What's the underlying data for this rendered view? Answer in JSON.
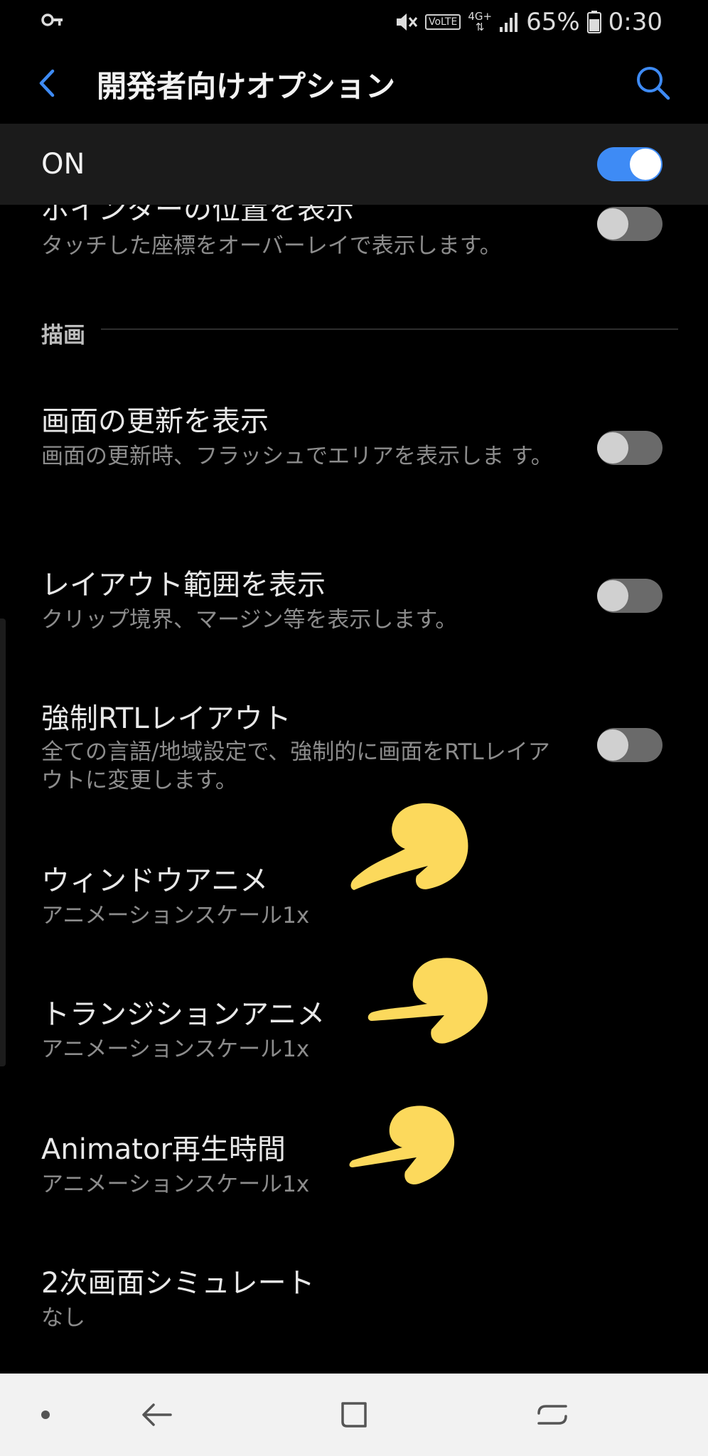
{
  "status_bar": {
    "volte": "VoLTE",
    "network": "4G+",
    "battery_percent": "65%",
    "time": "0:30"
  },
  "header": {
    "title": "開発者向けオプション"
  },
  "master_switch": {
    "label": "ON",
    "state": true
  },
  "rows": {
    "pointer_location": {
      "title": "ポインターの位置を表示",
      "subtitle": "タッチした座標をオーバーレイで表示します。",
      "enabled": false
    },
    "section": "描画",
    "show_surface_updates": {
      "title": "画面の更新を表示",
      "subtitle": "画面の更新時、フラッシュでエリアを表示しま す。",
      "enabled": false
    },
    "show_layout_bounds": {
      "title": "レイアウト範囲を表示",
      "subtitle": "クリップ境界、マージン等を表示します。",
      "enabled": false
    },
    "force_rtl": {
      "title": "強制RTLレイアウト",
      "subtitle": "全ての言語/地域設定で、強制的に画面をRTLレイアウトに変更します。",
      "enabled": false
    },
    "window_anim": {
      "title": "ウィンドウアニメ",
      "subtitle": "アニメーションスケール1x"
    },
    "transition_anim": {
      "title": "トランジションアニメ",
      "subtitle": "アニメーションスケール1x"
    },
    "animator_duration": {
      "title": "Animator再生時間",
      "subtitle": "アニメーションスケール1x"
    },
    "secondary_display": {
      "title": "2次画面シミュレート",
      "subtitle": "なし"
    }
  },
  "colors": {
    "accent": "#3e8bf5",
    "background": "#000000",
    "hand": "#fcd95c"
  }
}
